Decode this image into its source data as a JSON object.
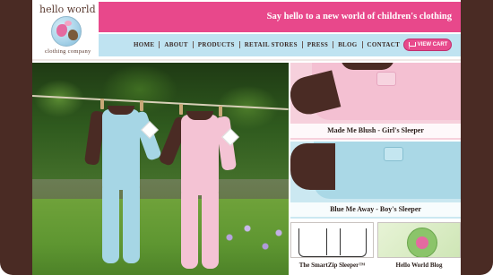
{
  "logo": {
    "line1": "hello world",
    "line2": "clothing company"
  },
  "banner": {
    "tagline": "Say hello to a new world of children's clothing"
  },
  "nav": {
    "items": [
      "HOME",
      "ABOUT",
      "PRODUCTS",
      "RETAIL STORES",
      "PRESS",
      "BLOG",
      "CONTACT"
    ],
    "cart_label": "VIEW CART"
  },
  "products": [
    {
      "caption": "Made Me Blush - Girl's Sleeper"
    },
    {
      "caption": "Blue Me Away - Boy's Sleeper"
    }
  ],
  "promo": {
    "smartzip": "The SmartZip Sleeper™",
    "blog": "Hello World Blog"
  },
  "colors": {
    "brand_pink": "#e8488b",
    "nav_blue": "#bfe3f1",
    "brand_brown": "#4a2b24"
  }
}
